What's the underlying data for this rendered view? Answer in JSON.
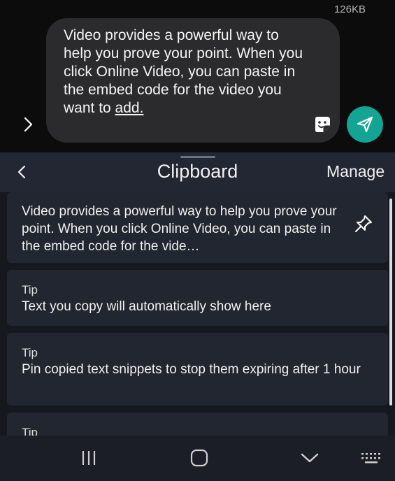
{
  "composer": {
    "size_label": "126KB",
    "message_main": "Video provides a powerful way to help you prove your point. When you click Online Video, you can paste in the embed code for the video you want to ",
    "message_link": "add.",
    "expand_icon": "chevron-right-icon",
    "sticker_icon": "sticker-icon",
    "send_icon": "send-icon",
    "send_color": "#13a493"
  },
  "clipboard": {
    "title": "Clipboard",
    "manage_label": "Manage",
    "back_icon": "chevron-left-icon",
    "items": [
      {
        "text": "Video provides a powerful way to help you prove your point. When you click Online Video, you can paste in the embed code for the vide…",
        "pin_icon": "pin-icon"
      },
      {
        "tip": "Tip",
        "text": "Text you copy will automatically show here"
      },
      {
        "tip": "Tip",
        "text": "Pin copied text snippets to stop them expiring after 1 hour"
      },
      {
        "tip": "Tip"
      }
    ]
  },
  "navbar": {
    "icons": [
      "recent-apps-icon",
      "home-icon",
      "hide-keyboard-icon",
      "keyboard-icon"
    ]
  }
}
